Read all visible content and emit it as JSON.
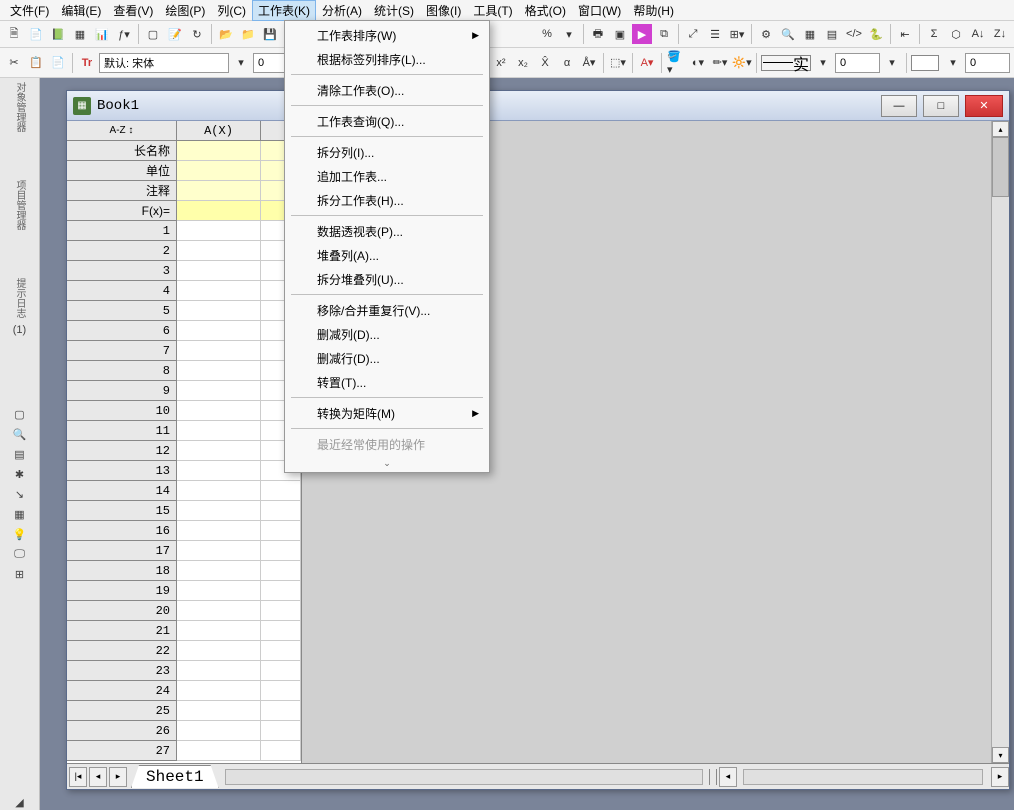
{
  "menubar": {
    "file": "文件(F)",
    "edit": "编辑(E)",
    "view": "查看(V)",
    "plot": "绘图(P)",
    "column": "列(C)",
    "worksheet": "工作表(K)",
    "analysis": "分析(A)",
    "statistics": "统计(S)",
    "image": "图像(I)",
    "tools": "工具(T)",
    "format": "格式(O)",
    "window": "窗口(W)",
    "help": "帮助(H)"
  },
  "dropdown": {
    "sort": "工作表排序(W)",
    "sort_label": "根据标签列排序(L)...",
    "clear": "清除工作表(O)...",
    "query": "工作表查询(Q)...",
    "split_col": "拆分列(I)...",
    "append": "追加工作表...",
    "split_ws": "拆分工作表(H)...",
    "pivot": "数据透视表(P)...",
    "stack": "堆叠列(A)...",
    "unstack": "拆分堆叠列(U)...",
    "remove_dup": "移除/合并重复行(V)...",
    "reduce_col": "删减列(D)...",
    "reduce_row": "删减行(D)...",
    "transpose": "转置(T)...",
    "to_matrix": "转换为矩阵(M)",
    "recent": "最近经常使用的操作"
  },
  "toolbar2": {
    "font_prefix": "默认: 宋体",
    "size": "0",
    "num2": "0",
    "num3": "0",
    "line_label": "实"
  },
  "toolbar": {
    "percent": "%"
  },
  "book": {
    "title": "Book1",
    "col_a": "A(X)",
    "row_labels": {
      "longname": "长名称",
      "units": "单位",
      "comments": "注释",
      "fx": "F(x)="
    },
    "sheet_tab": "Sheet1"
  }
}
